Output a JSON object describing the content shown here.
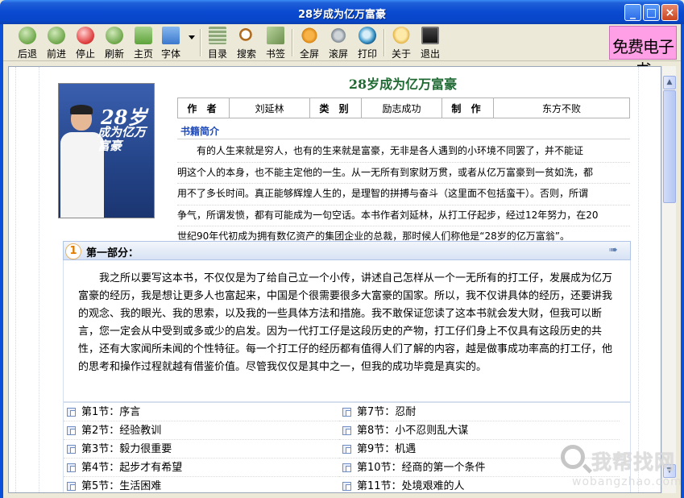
{
  "window": {
    "title": "28岁成为亿万富豪"
  },
  "toolbar": {
    "buttons": [
      {
        "label": "后退",
        "icon": "back-arrow-icon"
      },
      {
        "label": "前进",
        "icon": "forward-arrow-icon"
      },
      {
        "label": "停止",
        "icon": "stop-icon"
      },
      {
        "label": "刷新",
        "icon": "refresh-icon"
      },
      {
        "label": "主页",
        "icon": "home-icon"
      },
      {
        "label": "字体",
        "icon": "font-icon"
      },
      {
        "label": "目录",
        "icon": "catalog-icon"
      },
      {
        "label": "搜索",
        "icon": "search-icon"
      },
      {
        "label": "书签",
        "icon": "bookmark-icon"
      },
      {
        "label": "全屏",
        "icon": "fullscreen-icon"
      },
      {
        "label": "滚屏",
        "icon": "autoscroll-icon"
      },
      {
        "label": "打印",
        "icon": "print-icon"
      },
      {
        "label": "关于",
        "icon": "about-icon"
      },
      {
        "label": "退出",
        "icon": "exit-icon"
      }
    ],
    "promo": "免费电子书"
  },
  "book": {
    "title": "28岁成为亿万富豪",
    "meta": {
      "author_label": "作 者",
      "author": "刘延林",
      "category_label": "类 别",
      "category": "励志成功",
      "maker_label": "制 作",
      "maker": "东方不败"
    },
    "cover": {
      "number": "28岁",
      "title": "成为亿万富豪"
    },
    "intro_heading": "书籍简介",
    "intro_lines": [
      "有的人生来就是穷人，也有的生来就是富豪，无非是各人遇到的小环境不同罢了，并不能证",
      "明这个人的本身，也不能主定他的一生。从一无所有到家财万贯，或者从亿万富豪到一贫如洗，都",
      "用不了多长时间。真正能够辉煌人生的，是理智的拼搏与奋斗（这里面不包括蛮干）。否则，所谓",
      "争气，所谓发愤，都有可能成为一句空话。本书作者刘延林，从打工仔起步，经过12年努力，在20",
      "世纪90年代初成为拥有数亿资产的集团企业的总裁，那时候人们称他是“28岁的亿万富翁”。"
    ]
  },
  "part": {
    "number": "1",
    "title": "第一部分：",
    "text": "我之所以要写这本书，不仅仅是为了给自己立一个小传，讲述自己怎样从一个一无所有的打工仔，发展成为亿万富豪的经历，我是想让更多人也富起来，中国是个很需要很多大富豪的国家。所以，我不仅讲具体的经历，还要讲我的观念、我的眼光、我的思索，以及我的一些具体方法和措施。我不敢保证您读了这本书就会发大财，但我可以断言，您一定会从中受到或多或少的启发。因为一代打工仔是这段历史的产物，打工仔们身上不仅具有这段历史的共性，还有大家闻所未闻的个性特征。每一个打工仔的经历都有值得人们了解的内容，越是做事成功率高的打工仔，他的思考和操作过程就越有借鉴价值。尽管我仅仅是其中之一，但我的成功毕竟是真实的。"
  },
  "toc": {
    "left": [
      "第1节：序言",
      "第2节：经验教训",
      "第3节：毅力很重要",
      "第4节：起步才有希望",
      "第5节：生活困难"
    ],
    "right": [
      "第7节：忍耐",
      "第8节：小不忍则乱大谋",
      "第9节：机遇",
      "第10节：经商的第一个条件",
      "第11节：处境艰难的人"
    ]
  },
  "watermark": {
    "text": "我帮找网",
    "url": "wobangzhao.com"
  }
}
